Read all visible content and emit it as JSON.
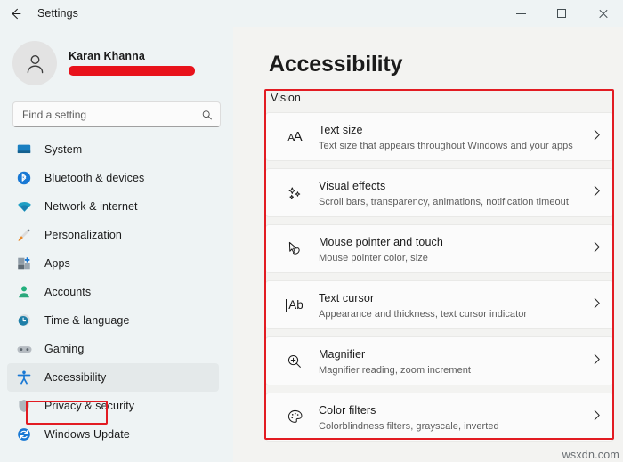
{
  "window": {
    "title": "Settings",
    "back_icon": "back-arrow-icon",
    "controls": {
      "minimize": "minimize-icon",
      "maximize": "maximize-icon",
      "close": "close-icon"
    }
  },
  "profile": {
    "name": "Karan Khanna",
    "email_redacted": true,
    "avatar_icon": "person-avatar-icon"
  },
  "search": {
    "placeholder": "Find a setting",
    "value": "",
    "icon": "search-icon"
  },
  "sidebar": {
    "items": [
      {
        "label": "System",
        "icon": "monitor-icon",
        "selected": false
      },
      {
        "label": "Bluetooth & devices",
        "icon": "bluetooth-icon",
        "selected": false
      },
      {
        "label": "Network & internet",
        "icon": "wifi-icon",
        "selected": false
      },
      {
        "label": "Personalization",
        "icon": "paintbrush-icon",
        "selected": false
      },
      {
        "label": "Apps",
        "icon": "apps-icon",
        "selected": false
      },
      {
        "label": "Accounts",
        "icon": "account-person-icon",
        "selected": false
      },
      {
        "label": "Time & language",
        "icon": "clock-icon",
        "selected": false
      },
      {
        "label": "Gaming",
        "icon": "gamepad-icon",
        "selected": false
      },
      {
        "label": "Accessibility",
        "icon": "accessibility-person-icon",
        "selected": true
      },
      {
        "label": "Privacy & security",
        "icon": "shield-icon",
        "selected": false
      },
      {
        "label": "Windows Update",
        "icon": "update-refresh-icon",
        "selected": false
      }
    ]
  },
  "main": {
    "title": "Accessibility",
    "section_label": "Vision",
    "cards": [
      {
        "title": "Text size",
        "subtitle": "Text size that appears throughout Windows and your apps",
        "icon": "text-size-aa-icon",
        "chevron": "chevron-right-icon"
      },
      {
        "title": "Visual effects",
        "subtitle": "Scroll bars, transparency, animations, notification timeout",
        "icon": "sparkles-icon",
        "chevron": "chevron-right-icon"
      },
      {
        "title": "Mouse pointer and touch",
        "subtitle": "Mouse pointer color, size",
        "icon": "mouse-pointer-touch-icon",
        "chevron": "chevron-right-icon"
      },
      {
        "title": "Text cursor",
        "subtitle": "Appearance and thickness, text cursor indicator",
        "icon": "text-cursor-ab-icon",
        "chevron": "chevron-right-icon"
      },
      {
        "title": "Magnifier",
        "subtitle": "Magnifier reading, zoom increment",
        "icon": "magnifier-plus-icon",
        "chevron": "chevron-right-icon"
      },
      {
        "title": "Color filters",
        "subtitle": "Colorblindness filters, grayscale, inverted",
        "icon": "color-palette-icon",
        "chevron": "chevron-right-icon"
      }
    ]
  },
  "annotations": {
    "color": "#e21b22",
    "boxes": [
      "sidebar-accessibility-highlight",
      "vision-section-highlight"
    ]
  },
  "watermark": {
    "text": "wsxdn.com"
  },
  "colors": {
    "sidebar_bg": "#eef3f4",
    "content_bg": "#f3f3f1",
    "card_bg": "#fbfbfb",
    "accent_red": "#e21b22",
    "text_primary": "#1b1b1b",
    "text_secondary": "#5d5d5d"
  }
}
